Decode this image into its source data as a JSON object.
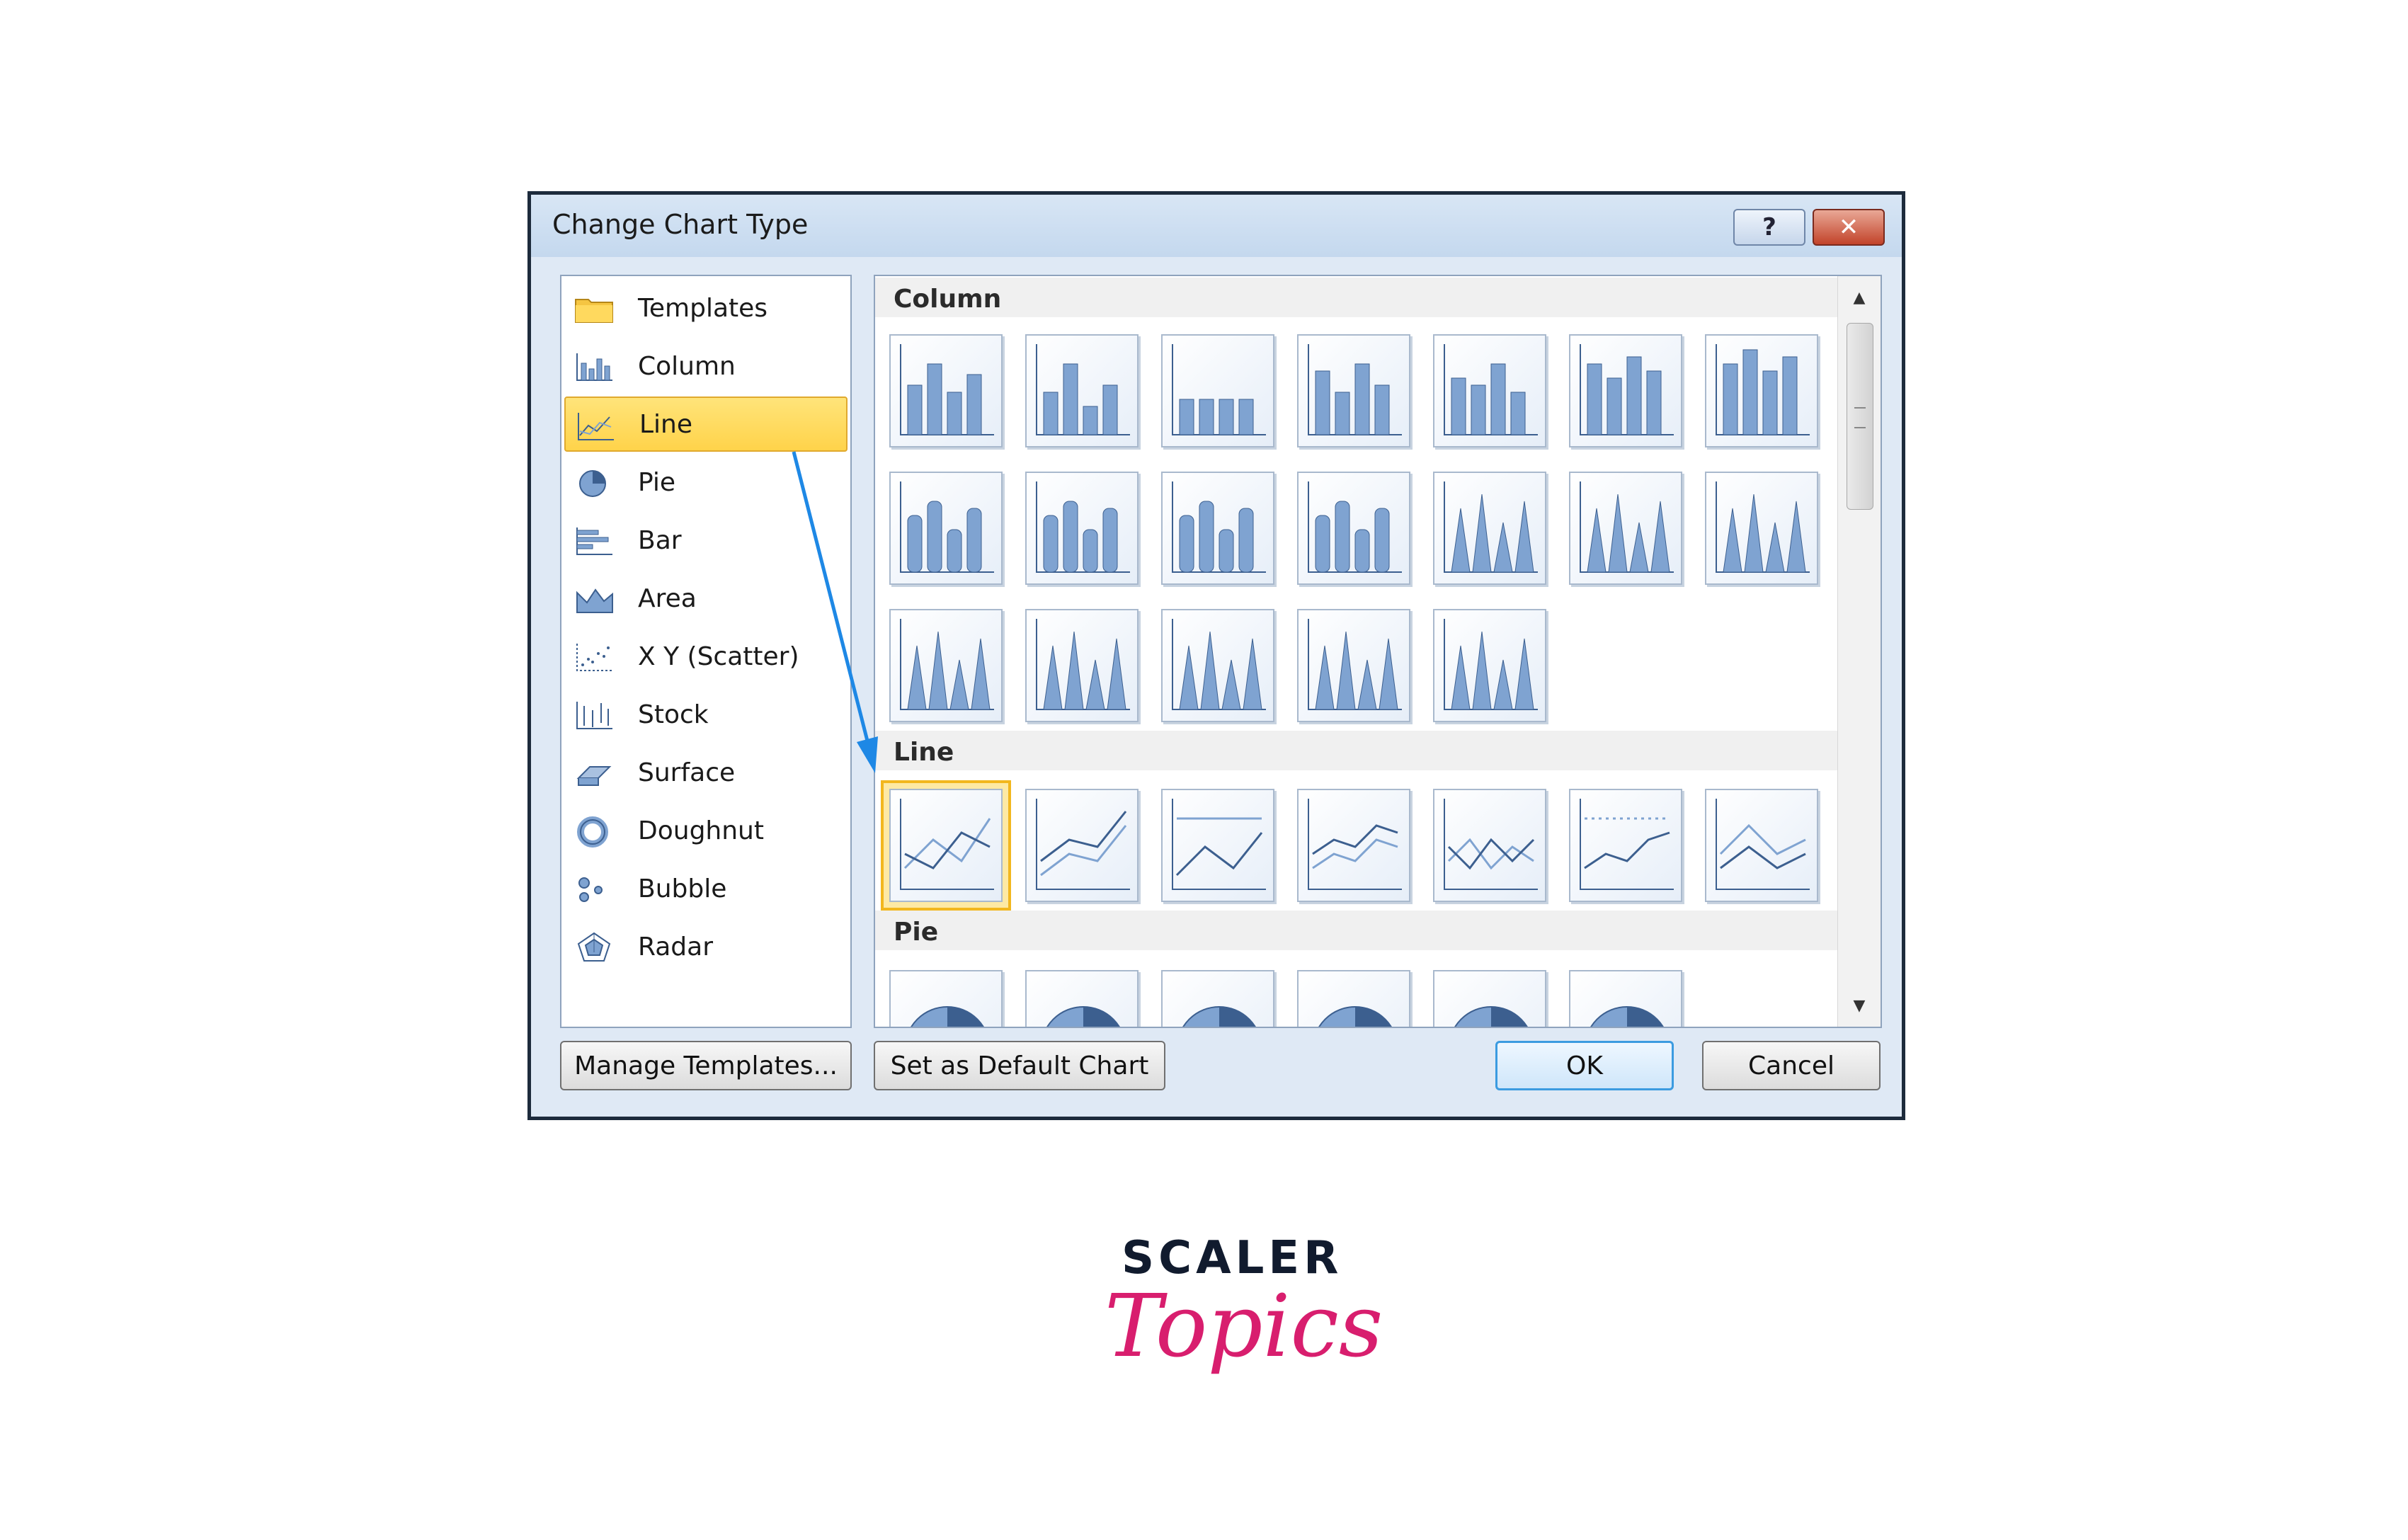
{
  "dialog": {
    "title": "Change Chart Type",
    "help_label": "?",
    "close_label": "✕"
  },
  "categories": [
    {
      "label": "Templates",
      "icon": "folder-icon"
    },
    {
      "label": "Column",
      "icon": "column-chart-icon"
    },
    {
      "label": "Line",
      "icon": "line-chart-icon",
      "selected": true
    },
    {
      "label": "Pie",
      "icon": "pie-chart-icon"
    },
    {
      "label": "Bar",
      "icon": "bar-chart-icon"
    },
    {
      "label": "Area",
      "icon": "area-chart-icon"
    },
    {
      "label": "X Y (Scatter)",
      "icon": "scatter-chart-icon"
    },
    {
      "label": "Stock",
      "icon": "stock-chart-icon"
    },
    {
      "label": "Surface",
      "icon": "surface-chart-icon"
    },
    {
      "label": "Doughnut",
      "icon": "doughnut-chart-icon"
    },
    {
      "label": "Bubble",
      "icon": "bubble-chart-icon"
    },
    {
      "label": "Radar",
      "icon": "radar-chart-icon"
    }
  ],
  "sections": [
    {
      "title": "Column"
    },
    {
      "title": "Line"
    },
    {
      "title": "Pie"
    }
  ],
  "buttons": {
    "manage_templates": "Manage Templates...",
    "set_default": "Set as Default Chart",
    "ok": "OK",
    "cancel": "Cancel"
  },
  "scrollbar": {
    "up_icon": "▲",
    "down_icon": "▼"
  },
  "logo": {
    "top": "SCALER",
    "bottom": "Topics"
  },
  "colors": {
    "accent_selected": "#ffd34a",
    "arrow": "#1e88e5",
    "logo_pink": "#d81e6e",
    "logo_dark": "#111b2e"
  }
}
